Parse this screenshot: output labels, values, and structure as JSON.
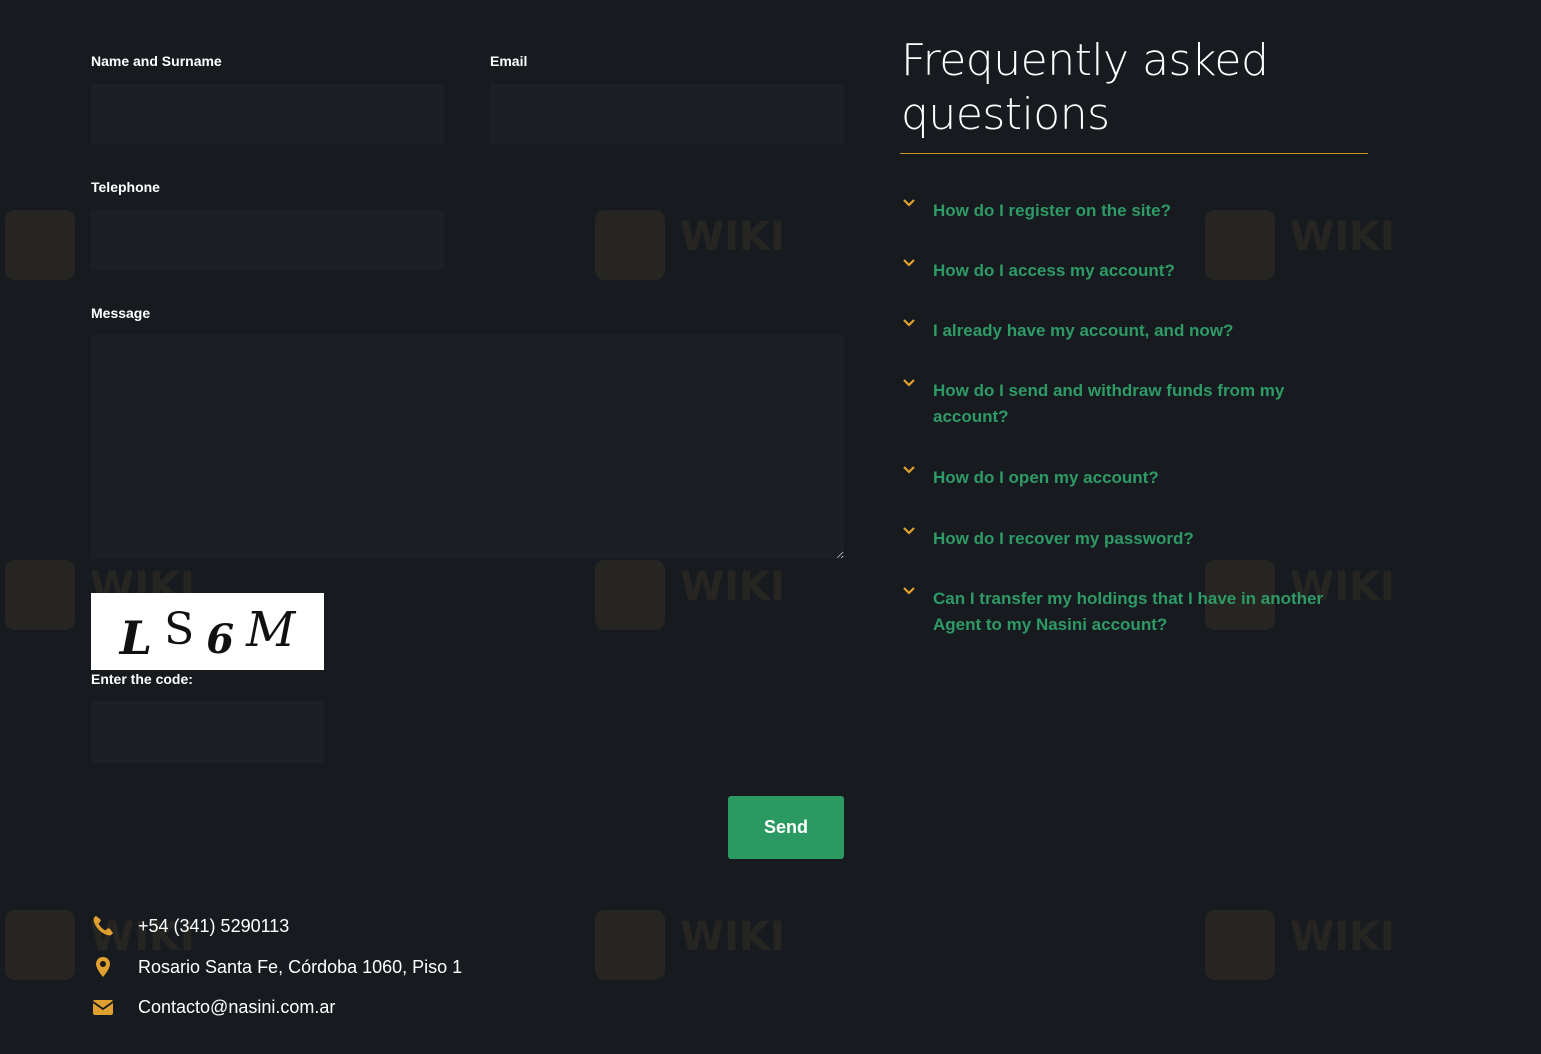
{
  "form": {
    "name_label": "Name and Surname",
    "email_label": "Email",
    "telephone_label": "Telephone",
    "message_label": "Message",
    "name_value": "",
    "email_value": "",
    "telephone_value": "",
    "message_value": "",
    "captcha_chars": [
      "L",
      "S",
      "6",
      "M"
    ],
    "captcha_label": "Enter the code:",
    "captcha_value": "",
    "send_label": "Send"
  },
  "faq": {
    "title": "Frequently asked questions",
    "items": [
      {
        "question": "How do I register on the site?"
      },
      {
        "question": "How do I access my account?"
      },
      {
        "question": "I already have my account, and now?"
      },
      {
        "question": "How do I send and withdraw funds from my account?"
      },
      {
        "question": "How do I open my account?"
      },
      {
        "question": "How do I recover my password?"
      },
      {
        "question": "Can I transfer my holdings that I have in another Agent to my Nasini account?"
      }
    ]
  },
  "contact": {
    "phone": "+54 (341) 5290113",
    "address": "Rosario Santa Fe, Córdoba 1060, Piso 1",
    "email": "Contacto@nasini.com.ar",
    "phone_icon": "phone-icon",
    "address_icon": "map-pin-icon",
    "email_icon": "envelope-icon"
  },
  "colors": {
    "background": "#171b20",
    "field": "#1c2026",
    "accent_green": "#2a9a62",
    "accent_gold": "#e0a030"
  }
}
